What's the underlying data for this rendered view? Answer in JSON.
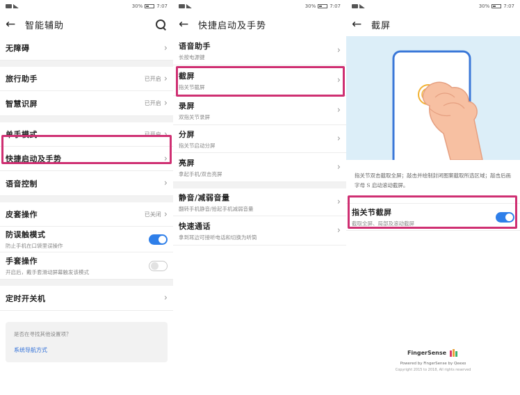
{
  "status": {
    "time": "7:07",
    "battery": "30%"
  },
  "panel1": {
    "title": "智能辅助",
    "rows": [
      {
        "label": "无障碍",
        "value": ""
      },
      {
        "label": "旅行助手",
        "value": "已开启"
      },
      {
        "label": "智慧识屏",
        "value": "已开启"
      },
      {
        "label": "单手模式",
        "value": "已开启"
      },
      {
        "label": "快捷启动及手势",
        "value": ""
      },
      {
        "label": "语音控制",
        "value": ""
      },
      {
        "label": "皮套操作",
        "value": "已关闭"
      },
      {
        "label": "防误触模式",
        "sub": "防止手机在口袋里误操作"
      },
      {
        "label": "手套操作",
        "sub": "开启后，戴手套滑动屏幕触发该模式"
      },
      {
        "label": "定时开关机",
        "value": ""
      }
    ],
    "hint_question": "是否在寻找其他设置项？",
    "hint_link": "系统导航方式"
  },
  "panel2": {
    "title": "快捷启动及手势",
    "rows": [
      {
        "label": "语音助手",
        "sub": "长按电源键"
      },
      {
        "label": "截屏",
        "sub": "指关节截屏"
      },
      {
        "label": "录屏",
        "sub": "双指关节录屏"
      },
      {
        "label": "分屏",
        "sub": "指关节启动分屏"
      },
      {
        "label": "亮屏",
        "sub": "拿起手机/双击亮屏"
      },
      {
        "label": "静音/减弱音量",
        "sub": "翻转手机静音/拾起手机减弱音量"
      },
      {
        "label": "快速通话",
        "sub": "拿到耳边可接听电话和切换为听筒"
      }
    ]
  },
  "panel3": {
    "title": "截屏",
    "description": "指关节双击截取全屏；敲击并绘制封闭图案截取所选区域；敲击后画字母 S 启动滚动截屏。",
    "row_label": "指关节截屏",
    "row_sub": "截取全屏、局部及滚动截屏",
    "footer_brand": "FingerSense",
    "footer_powered": "Powered by FingerSense by Qeexo",
    "footer_copyright": "Copyright 2015 to 2018, All rights reserved"
  },
  "colors": {
    "accent": "#2f7fe9",
    "highlight": "#cf2f72",
    "illustration_bg": "#dceef8"
  }
}
